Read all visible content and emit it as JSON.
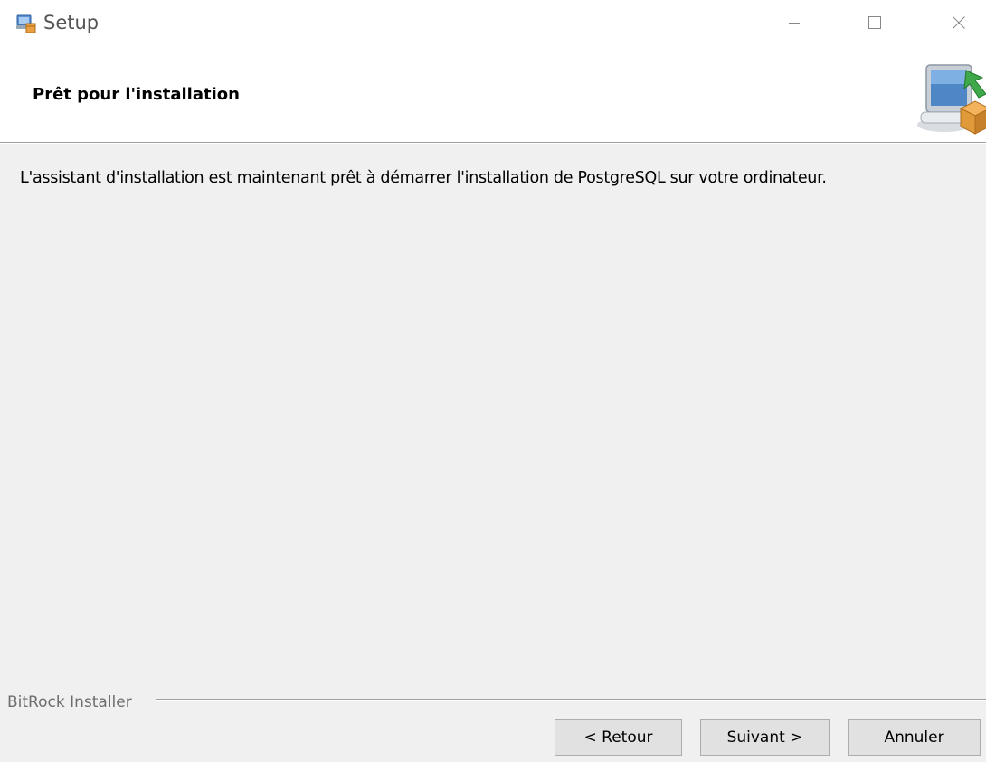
{
  "window": {
    "title": "Setup",
    "controls": {
      "minimize": "minimize-icon",
      "maximize": "maximize-icon",
      "close": "close-icon"
    }
  },
  "header": {
    "title": "Prêt pour l'installation",
    "graphic": "installer-computer-box-icon"
  },
  "body": {
    "message": "L'assistant d'installation est maintenant prêt à démarrer l'installation de PostgreSQL sur votre ordinateur."
  },
  "footer": {
    "brand": "BitRock Installer",
    "buttons": {
      "back": "< Retour",
      "next": "Suivant >",
      "cancel": "Annuler"
    }
  },
  "colors": {
    "window_bg": "#f0f0f0",
    "header_bg": "#ffffff",
    "button_bg": "#e1e1e1",
    "button_border": "#adadad",
    "brand_text": "#6d6d6d"
  }
}
